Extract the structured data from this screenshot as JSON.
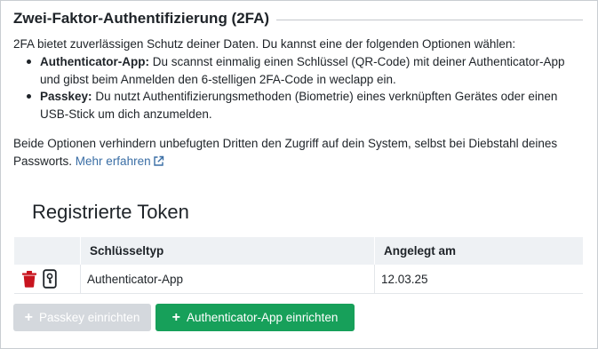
{
  "section": {
    "title": "Zwei-Faktor-Authentifizierung (2FA)"
  },
  "intro": "2FA bietet zuverlässigen Schutz deiner Daten. Du kannst eine der folgenden Optionen wählen:",
  "options": [
    {
      "name": "Authenticator-App:",
      "text": "Du scannst einmalig einen Schlüssel (QR-Code) mit deiner Authenticator-App und gibst beim Anmelden den 6-stelligen 2FA-Code in weclapp ein."
    },
    {
      "name": "Passkey:",
      "text": "Du nutzt Authentifizierungsmethoden (Biometrie) eines verknüpften Gerätes oder einen USB-Stick um dich anzumelden."
    }
  ],
  "note": {
    "text": "Beide Optionen verhindern unbefugten Dritten den Zugriff auf dein System, selbst bei Diebstahl deines Passworts.",
    "link_label": "Mehr erfahren",
    "link_icon": "external-link-icon"
  },
  "tokens": {
    "title": "Registrierte Token",
    "columns": [
      "",
      "Schlüsseltyp",
      "Angelegt am"
    ],
    "rows": [
      {
        "type": "Authenticator-App",
        "created": "12.03.25"
      }
    ],
    "row_icons": [
      "trash-icon",
      "phone-key-icon"
    ]
  },
  "buttons": {
    "passkey": {
      "label": "Passkey einrichten",
      "enabled": false
    },
    "authenticator": {
      "label": "Authenticator-App einrichten",
      "enabled": true
    }
  },
  "colors": {
    "primary": "#17a05a",
    "disabled": "#d4d8dd",
    "link": "#3a6ea5",
    "delete": "#c8141e",
    "table_header": "#eef1f4"
  }
}
